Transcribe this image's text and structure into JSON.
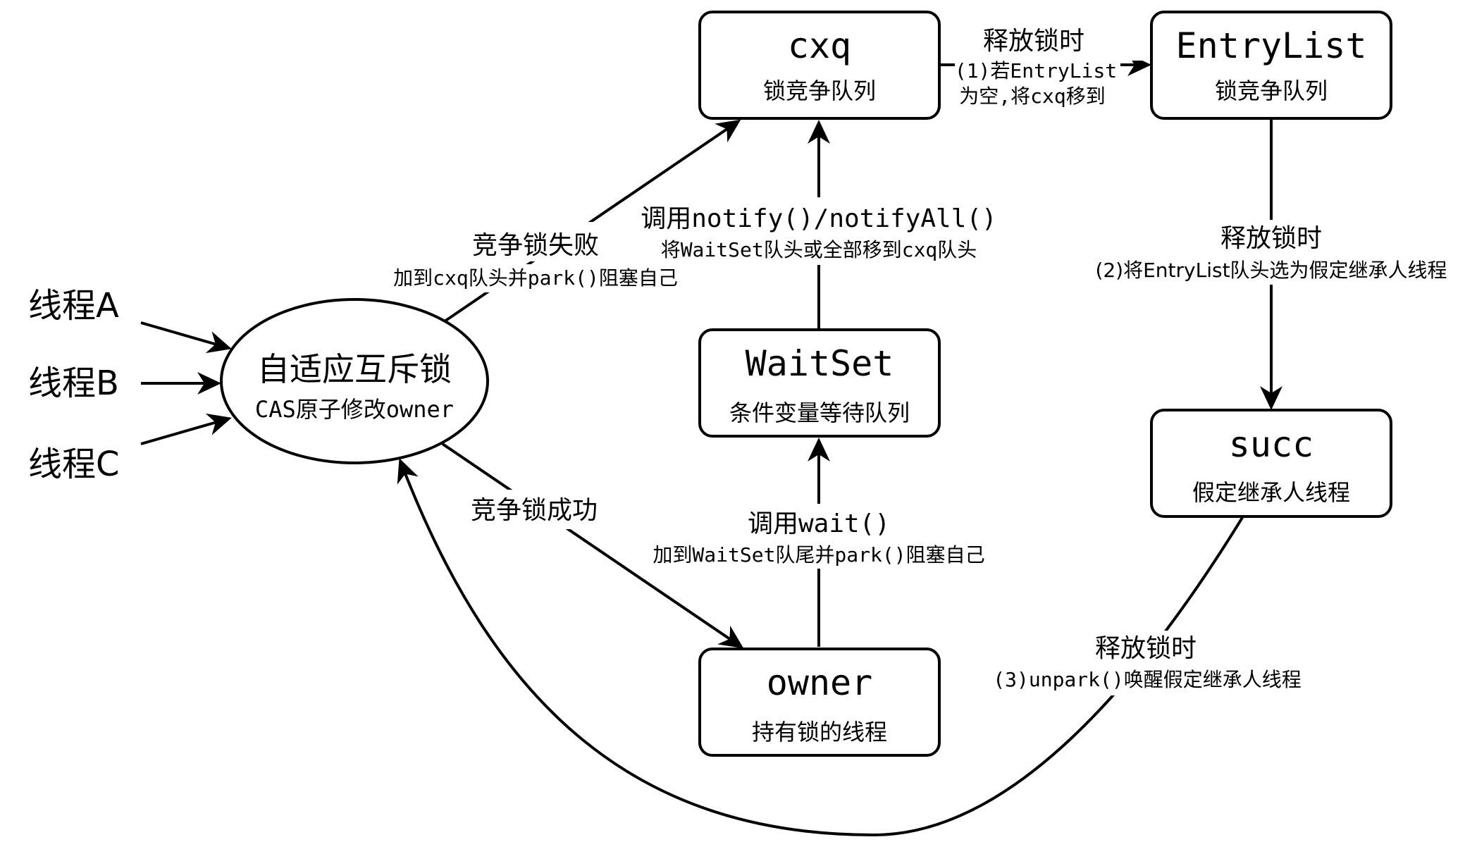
{
  "threads": [
    "线程A",
    "线程B",
    "线程C"
  ],
  "mutex": {
    "title": "自适应互斥锁",
    "sub": "CAS原子修改owner"
  },
  "nodes": {
    "cxq": {
      "title": "cxq",
      "sub": "锁竞争队列"
    },
    "entrylist": {
      "title": "EntryList",
      "sub": "锁竞争队列"
    },
    "waitset": {
      "title": "WaitSet",
      "sub": "条件变量等待队列"
    },
    "succ": {
      "title": "succ",
      "sub": "假定继承人线程"
    },
    "owner": {
      "title": "owner",
      "sub": "持有锁的线程"
    }
  },
  "edges": {
    "fail": {
      "label": "竞争锁失败",
      "note": "加到cxq队头并park()阻塞自己"
    },
    "success": {
      "label": "竞争锁成功"
    },
    "notify": {
      "label": "调用notify()/notifyAll()",
      "note": "将WaitSet队头或全部移到cxq队头"
    },
    "wait": {
      "label": "调用wait()",
      "note": "加到WaitSet队尾并park()阻塞自己"
    },
    "release1": {
      "label": "释放锁时",
      "note_line1": "(1)若EntryList",
      "note_line2": "为空,将cxq移到"
    },
    "release2": {
      "label": "释放锁时",
      "note": "(2)将EntryList队头选为假定继承人线程"
    },
    "release3": {
      "label": "释放锁时",
      "note": "(3)unpark()唤醒假定继承人线程"
    }
  }
}
